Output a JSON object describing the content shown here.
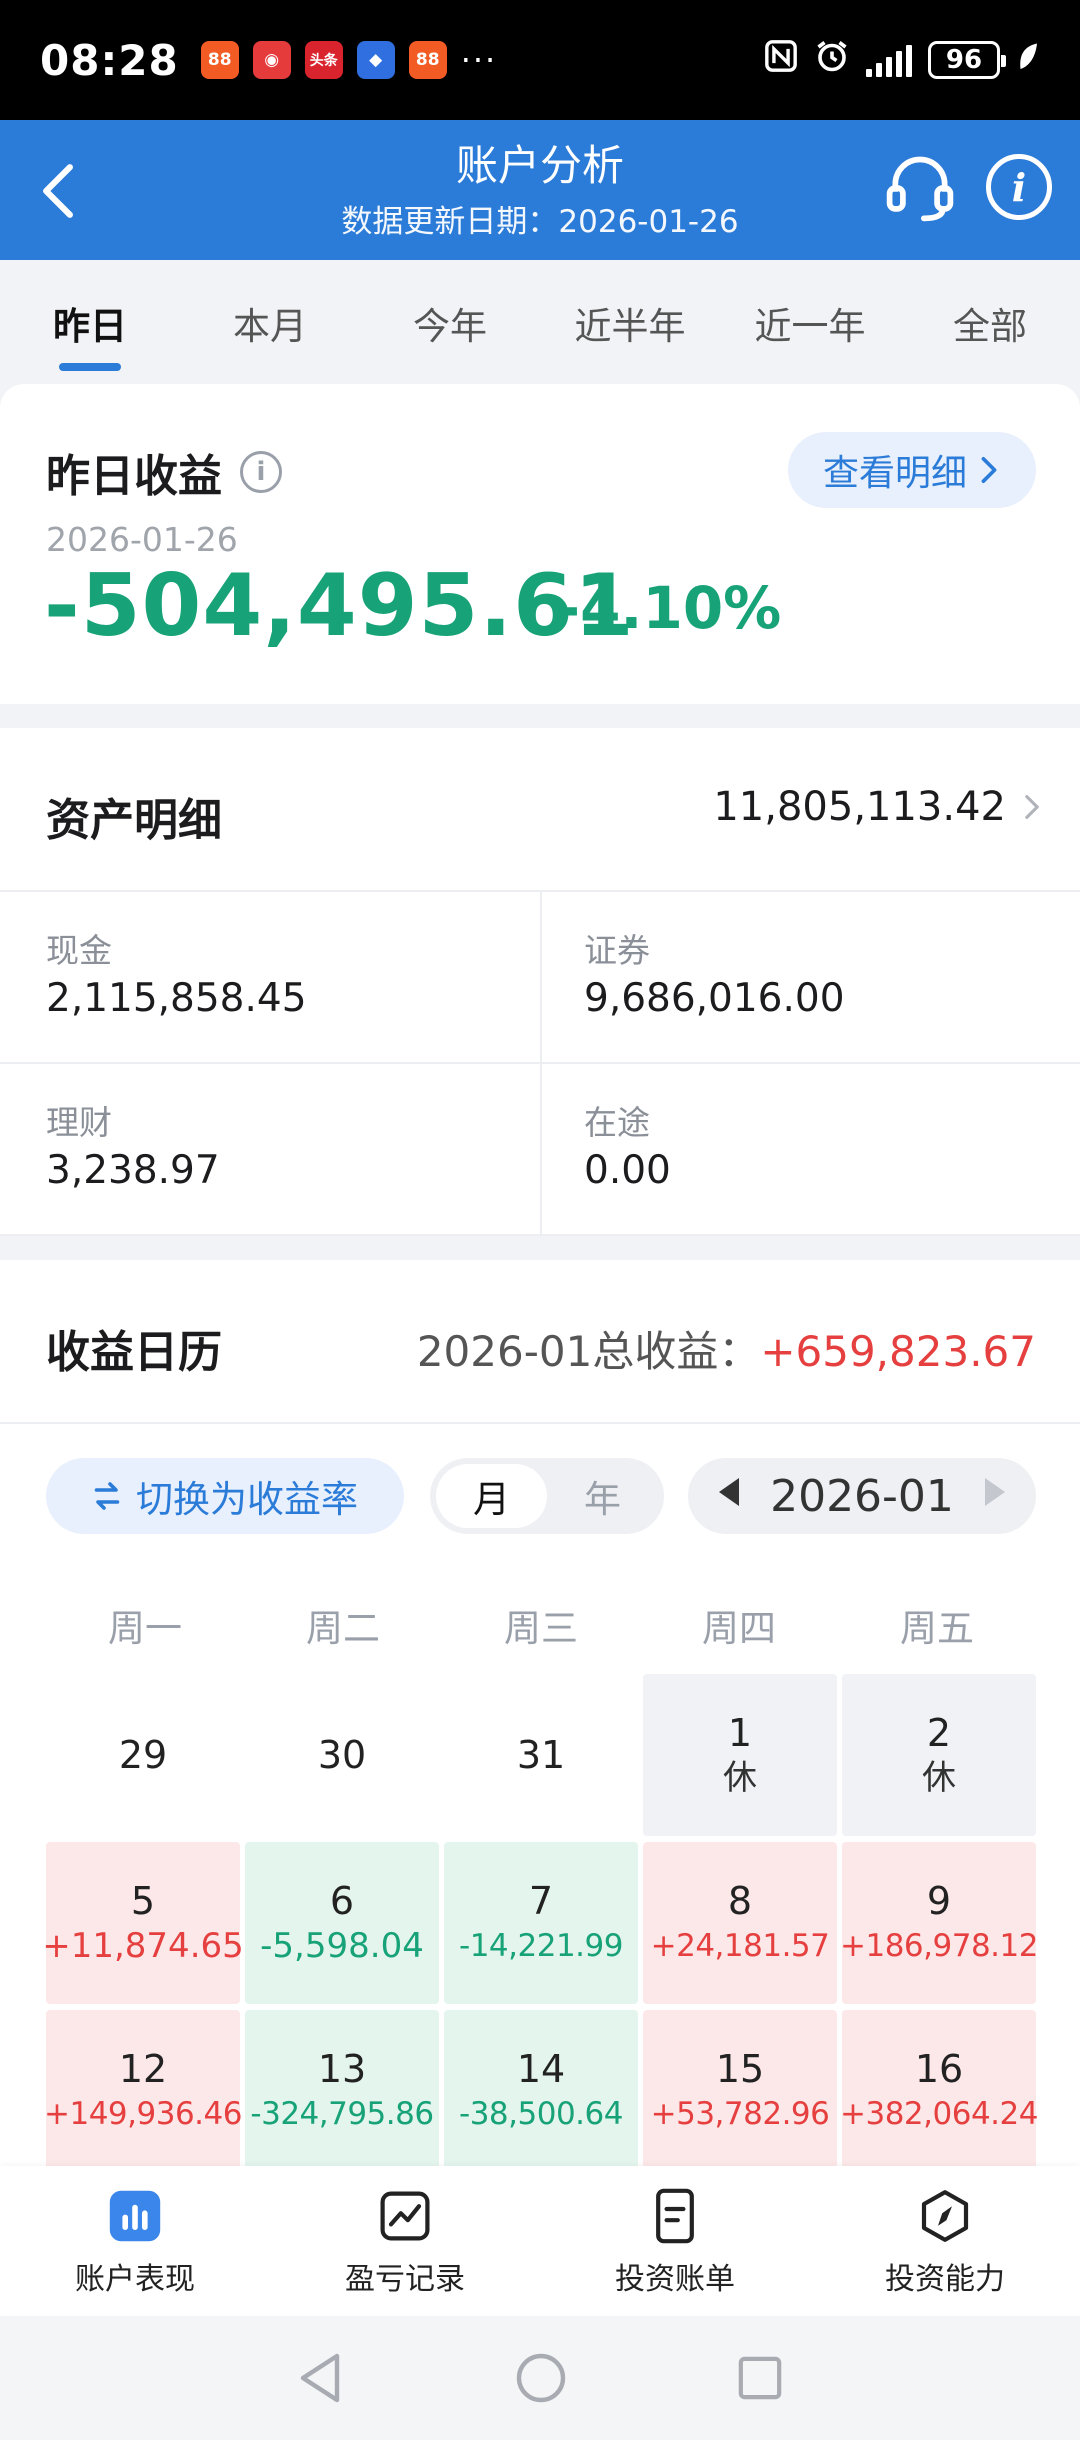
{
  "status_bar": {
    "time": "08:28",
    "app_badges": [
      {
        "icon": "app-orange-icon",
        "glyph": "88",
        "color": "#f35b24"
      },
      {
        "icon": "app-red-icon",
        "glyph": "◉",
        "color": "#e63b3b"
      },
      {
        "icon": "toutiao-icon",
        "glyph": "头条",
        "color": "#d9232d"
      },
      {
        "icon": "app-blue-icon",
        "glyph": "◆",
        "color": "#2f6fe0"
      },
      {
        "icon": "app-orange2-icon",
        "glyph": "88",
        "color": "#f35b24"
      }
    ],
    "more": "···",
    "battery": "96"
  },
  "header": {
    "title": "账户分析",
    "subtitle": "数据更新日期：2026-01-26"
  },
  "tabs": [
    {
      "label": "昨日",
      "active": true
    },
    {
      "label": "本月"
    },
    {
      "label": "今年"
    },
    {
      "label": "近半年"
    },
    {
      "label": "近一年"
    },
    {
      "label": "全部"
    }
  ],
  "profit": {
    "title": "昨日收益",
    "detail_button": "查看明细",
    "date": "2026-01-26",
    "amount": "-504,495.61",
    "rate": "-4.10%"
  },
  "assets": {
    "title": "资产明细",
    "total": "11,805,113.42",
    "cells": [
      {
        "label": "现金",
        "value": "2,115,858.45"
      },
      {
        "label": "证券",
        "value": "9,686,016.00"
      },
      {
        "label": "理财",
        "value": "3,238.97"
      },
      {
        "label": "在途",
        "value": "0.00"
      }
    ]
  },
  "calendar": {
    "title": "收益日历",
    "total_label": "2026-01总收益：",
    "total_value": "+659,823.67",
    "switch_button": "切换为收益率",
    "segments": [
      "月",
      "年"
    ],
    "month": "2026-01",
    "weekdays": [
      "周一",
      "周二",
      "周三",
      "周四",
      "周五"
    ],
    "days": [
      {
        "day": "29",
        "sub": "",
        "state": "plain"
      },
      {
        "day": "30",
        "sub": "",
        "state": "plain"
      },
      {
        "day": "31",
        "sub": "",
        "state": "plain"
      },
      {
        "day": "1",
        "sub": "休",
        "state": "rest"
      },
      {
        "day": "2",
        "sub": "休",
        "state": "rest"
      },
      {
        "day": "5",
        "sub": "+11,874.65",
        "state": "gain"
      },
      {
        "day": "6",
        "sub": "-5,598.04",
        "state": "loss"
      },
      {
        "day": "7",
        "sub": "-14,221.99",
        "state": "loss"
      },
      {
        "day": "8",
        "sub": "+24,181.57",
        "state": "gain"
      },
      {
        "day": "9",
        "sub": "+186,978.12",
        "state": "gain"
      },
      {
        "day": "12",
        "sub": "+149,936.46",
        "state": "gain"
      },
      {
        "day": "13",
        "sub": "-324,795.86",
        "state": "loss"
      },
      {
        "day": "14",
        "sub": "-38,500.64",
        "state": "loss"
      },
      {
        "day": "15",
        "sub": "+53,782.96",
        "state": "gain"
      },
      {
        "day": "16",
        "sub": "+382,064.24",
        "state": "gain"
      }
    ]
  },
  "bottom_nav": [
    {
      "label": "账户表现",
      "icon": "bar-chart-icon",
      "active": true
    },
    {
      "label": "盈亏记录",
      "icon": "line-chart-icon"
    },
    {
      "label": "投资账单",
      "icon": "bill-icon"
    },
    {
      "label": "投资能力",
      "icon": "compass-icon"
    }
  ],
  "colors": {
    "brand": "#2b7bd8",
    "gain": "#e5403f",
    "loss": "#17a277"
  }
}
